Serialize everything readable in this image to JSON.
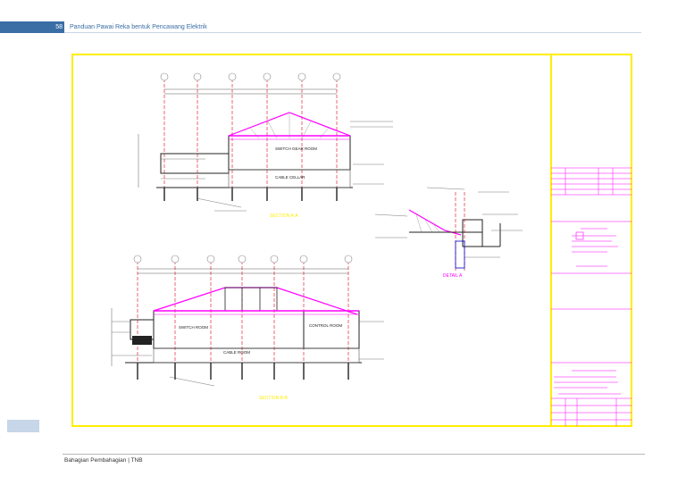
{
  "header": {
    "page_number": "58",
    "title": "Panduan Pawai Reka bentuk Pencawang Elektrik"
  },
  "drawing": {
    "section_top_label": "SECTION A-A",
    "section_bottom_label": "SECTION B-B",
    "detail_label": "DETAIL A",
    "room_labels_top": [
      "SWITCH GEAR ROOM",
      "CABLE CELLAR"
    ],
    "room_labels_bottom": [
      "SWITCH ROOM",
      "CONTROL ROOM",
      "CABLE ROOM"
    ],
    "border_color": "#ffee00",
    "line_color": "#ff00ff",
    "axis_color": "#e0001a"
  },
  "footer": {
    "text": "Bahagian Pembahagian | TNB"
  }
}
